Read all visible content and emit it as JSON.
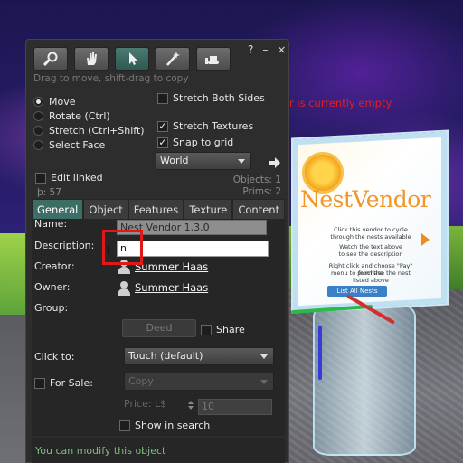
{
  "scene": {
    "empty_message": "r is currently empty",
    "vendor": {
      "name": "NestVendor",
      "lines": [
        "Click this vendor to cycle",
        "through the nests available",
        "Watch the text above",
        "to see the description",
        "Right click and choose \"Pay\" from the",
        "menu to purchase the nest listed above"
      ],
      "button": "List All Nests"
    }
  },
  "floater": {
    "tools": [
      {
        "name": "focus-tool",
        "icon": "magnifier-icon"
      },
      {
        "name": "move-tool",
        "icon": "hand-icon"
      },
      {
        "name": "edit-tool",
        "icon": "cursor-icon"
      },
      {
        "name": "create-tool",
        "icon": "wand-icon"
      },
      {
        "name": "land-tool",
        "icon": "bulldozer-icon"
      }
    ],
    "window_controls": {
      "help": "?",
      "minimize": "–",
      "close": "×"
    },
    "hint": "Drag to move, shift-drag to copy",
    "modes": [
      {
        "label": "Move",
        "selected": true
      },
      {
        "label": "Rotate (Ctrl)",
        "selected": false
      },
      {
        "label": "Stretch (Ctrl+Shift)",
        "selected": false
      },
      {
        "label": "Select Face",
        "selected": false
      }
    ],
    "options": {
      "stretch_both_sides": {
        "label": "Stretch Both Sides",
        "checked": false
      },
      "stretch_textures": {
        "label": "Stretch Textures",
        "checked": true
      },
      "snap_to_grid": {
        "label": "Snap to grid",
        "checked": true
      },
      "edit_linked": {
        "label": "Edit linked",
        "checked": false
      }
    },
    "grid_ruler": "World",
    "objects_count": "Objects: 1",
    "prims_count": "Prims: 2",
    "prim_id": "þ: 57",
    "tabs": [
      "General",
      "Object",
      "Features",
      "Texture",
      "Content"
    ],
    "active_tab": "General",
    "general": {
      "name_label": "Name:",
      "name_value": "Nest Vendor 1.3.0",
      "description_label": "Description:",
      "description_value": "n",
      "creator_label": "Creator:",
      "creator_value": "Summer Haas",
      "owner_label": "Owner:",
      "owner_value": "Summer Haas",
      "group_label": "Group:",
      "deed_label": "Deed",
      "share_label": "Share",
      "click_to_label": "Click to:",
      "click_to_value": "Touch  (default)",
      "for_sale_label": "For Sale:",
      "sale_type_value": "Copy",
      "price_label": "Price: L$",
      "price_value": "10",
      "show_in_search_label": "Show in search"
    },
    "status_text": "You can modify this object"
  }
}
